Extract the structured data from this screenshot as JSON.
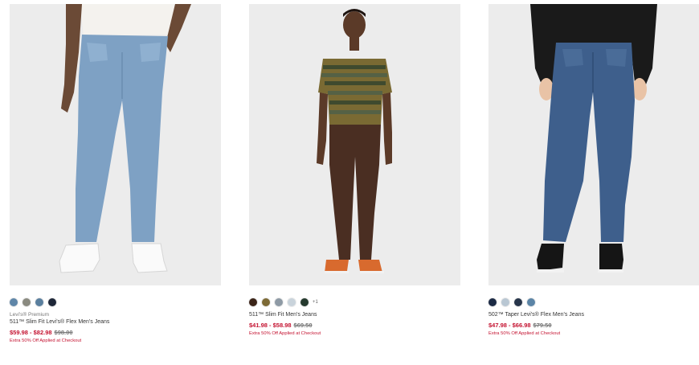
{
  "products": [
    {
      "image_alt": "511 Slim Fit Levi's Flex Men's Jeans - light wash",
      "swatches": [
        "#5f86a8",
        "#8a8a80",
        "#5a7f9e",
        "#1e2738"
      ],
      "more_label": "",
      "brand": "Levi's® Premium",
      "name": "511™ Slim Fit Levi's® Flex Men's Jeans",
      "sale_price": "$59.98 - $82.98",
      "original_price": "$98.00",
      "promo": "Extra 50% Off Applied at Checkout"
    },
    {
      "image_alt": "511 Slim Fit Men's Jeans - brown",
      "swatches": [
        "#3b2418",
        "#7d6a36",
        "#8e9aa5",
        "#c9d3db",
        "#253a2e"
      ],
      "more_label": "+1",
      "brand": "",
      "name": "511™ Slim Fit Men's Jeans",
      "sale_price": "$41.98 - $58.98",
      "original_price": "$69.50",
      "promo": "Extra 50% Off Applied at Checkout"
    },
    {
      "image_alt": "502 Taper Levi's Flex Men's Jeans - dark wash",
      "swatches": [
        "#1c2a44",
        "#b9c7d3",
        "#27354a",
        "#5b84a6"
      ],
      "more_label": "",
      "brand": "",
      "name": "502™ Taper Levi's® Flex Men's Jeans",
      "sale_price": "$47.98 - $66.98",
      "original_price": "$79.50",
      "promo": "Extra 50% Off Applied at Checkout"
    }
  ]
}
